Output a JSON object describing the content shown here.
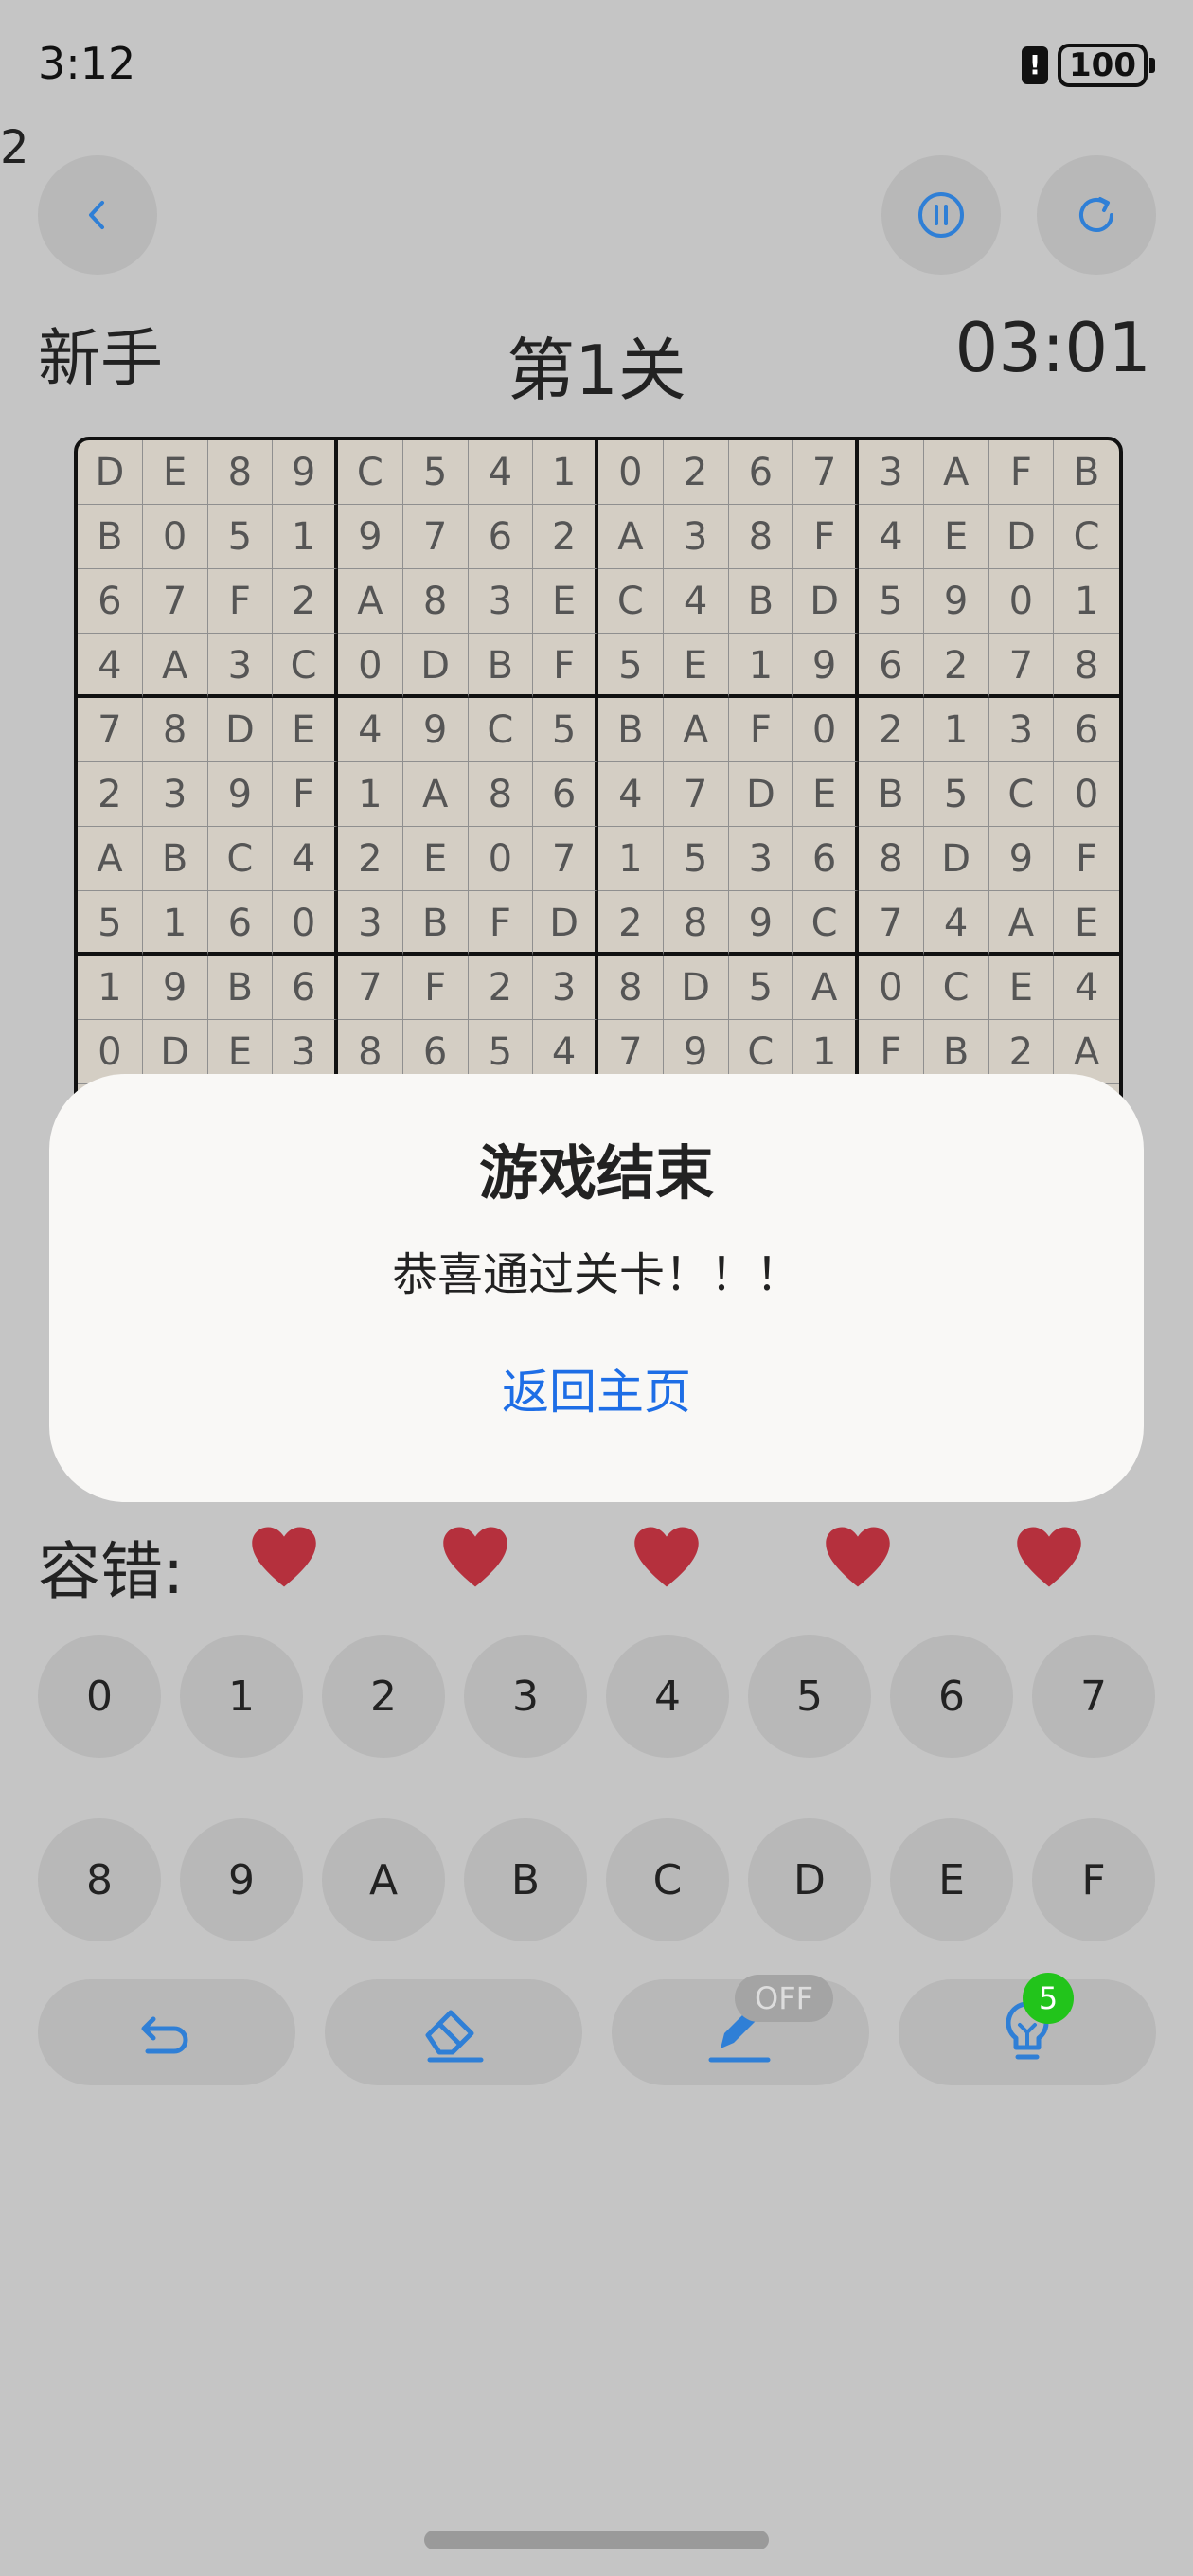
{
  "status_bar": {
    "time": "3:12",
    "battery": "100"
  },
  "stray_text": "2",
  "header": {
    "difficulty": "新手",
    "level": "第1关",
    "timer": "03:01"
  },
  "board": {
    "rows": [
      [
        "D",
        "E",
        "8",
        "9",
        "C",
        "5",
        "4",
        "1",
        "0",
        "2",
        "6",
        "7",
        "3",
        "A",
        "F",
        "B"
      ],
      [
        "B",
        "0",
        "5",
        "1",
        "9",
        "7",
        "6",
        "2",
        "A",
        "3",
        "8",
        "F",
        "4",
        "E",
        "D",
        "C"
      ],
      [
        "6",
        "7",
        "F",
        "2",
        "A",
        "8",
        "3",
        "E",
        "C",
        "4",
        "B",
        "D",
        "5",
        "9",
        "0",
        "1"
      ],
      [
        "4",
        "A",
        "3",
        "C",
        "0",
        "D",
        "B",
        "F",
        "5",
        "E",
        "1",
        "9",
        "6",
        "2",
        "7",
        "8"
      ],
      [
        "7",
        "8",
        "D",
        "E",
        "4",
        "9",
        "C",
        "5",
        "B",
        "A",
        "F",
        "0",
        "2",
        "1",
        "3",
        "6"
      ],
      [
        "2",
        "3",
        "9",
        "F",
        "1",
        "A",
        "8",
        "6",
        "4",
        "7",
        "D",
        "E",
        "B",
        "5",
        "C",
        "0"
      ],
      [
        "A",
        "B",
        "C",
        "4",
        "2",
        "E",
        "0",
        "7",
        "1",
        "5",
        "3",
        "6",
        "8",
        "D",
        "9",
        "F"
      ],
      [
        "5",
        "1",
        "6",
        "0",
        "3",
        "B",
        "F",
        "D",
        "2",
        "8",
        "9",
        "C",
        "7",
        "4",
        "A",
        "E"
      ],
      [
        "1",
        "9",
        "B",
        "6",
        "7",
        "F",
        "2",
        "3",
        "8",
        "D",
        "5",
        "A",
        "0",
        "C",
        "E",
        "4"
      ],
      [
        "0",
        "D",
        "E",
        "3",
        "8",
        "6",
        "5",
        "4",
        "7",
        "9",
        "C",
        "1",
        "F",
        "B",
        "2",
        "A"
      ]
    ]
  },
  "dialog": {
    "title": "游戏结束",
    "message": "恭喜通过关卡！！！",
    "button": "返回主页"
  },
  "lives": {
    "label": "容错:",
    "count": 5,
    "color": "#b5303d"
  },
  "keypad": {
    "row1": [
      "0",
      "1",
      "2",
      "3",
      "4",
      "5",
      "6",
      "7"
    ],
    "row2": [
      "8",
      "9",
      "A",
      "B",
      "C",
      "D",
      "E",
      "F"
    ]
  },
  "tools": {
    "undo_icon": "undo-icon",
    "erase_icon": "eraser-icon",
    "notes_icon": "pencil-icon",
    "notes_toggle": "OFF",
    "hint_icon": "lightbulb-icon",
    "hint_count": "5"
  },
  "colors": {
    "accent": "#1e6ee6",
    "icon_blue": "#2f7fd6",
    "badge_green": "#22c41b"
  }
}
